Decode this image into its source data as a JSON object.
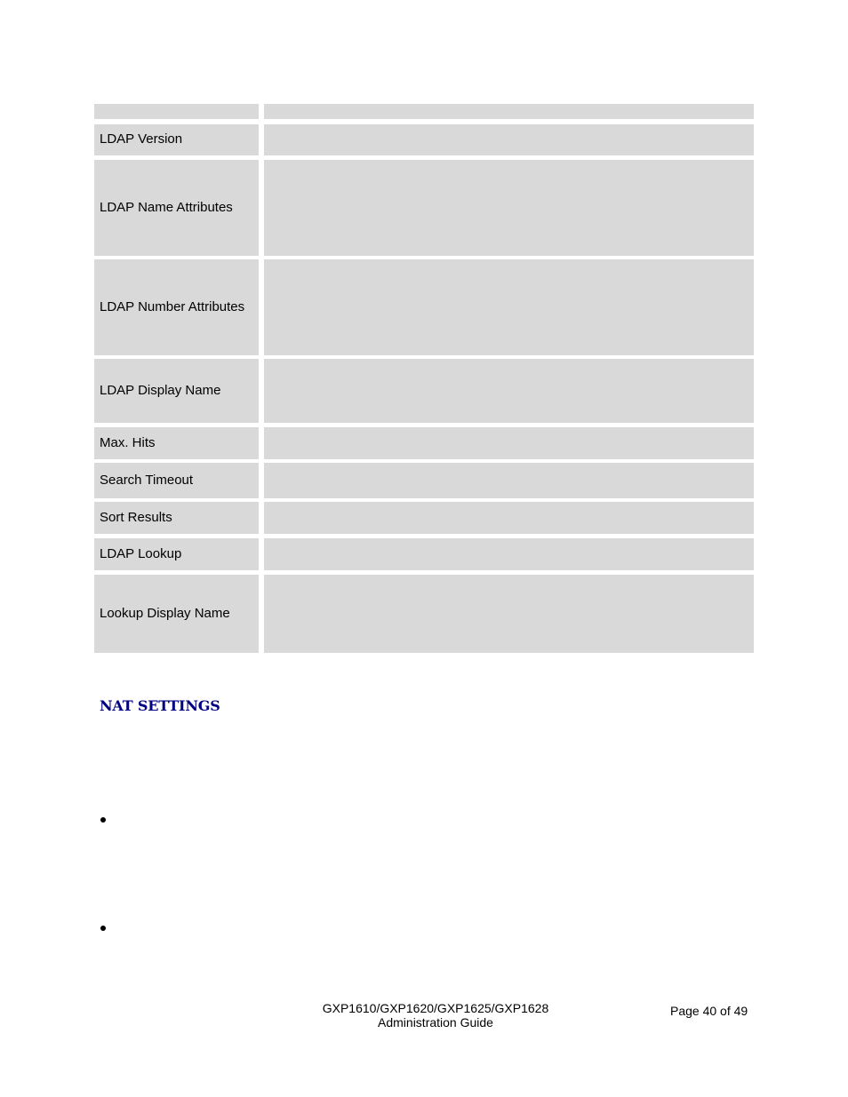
{
  "table": {
    "rows": [
      {
        "label": ""
      },
      {
        "label": "LDAP Version"
      },
      {
        "label": "LDAP Name Attributes"
      },
      {
        "label": "LDAP Number Attributes"
      },
      {
        "label": "LDAP Display Name"
      },
      {
        "label": "Max. Hits"
      },
      {
        "label": "Search Timeout"
      },
      {
        "label": "Sort Results"
      },
      {
        "label": "LDAP Lookup"
      },
      {
        "label": "Lookup Display Name"
      }
    ]
  },
  "section": {
    "heading": "NAT SETTINGS",
    "bullets": [
      "",
      ""
    ]
  },
  "footer": {
    "product_line": "GXP1610/GXP1620/GXP1625/GXP1628",
    "doc_title": "Administration Guide",
    "page": "Page 40 of 49"
  }
}
